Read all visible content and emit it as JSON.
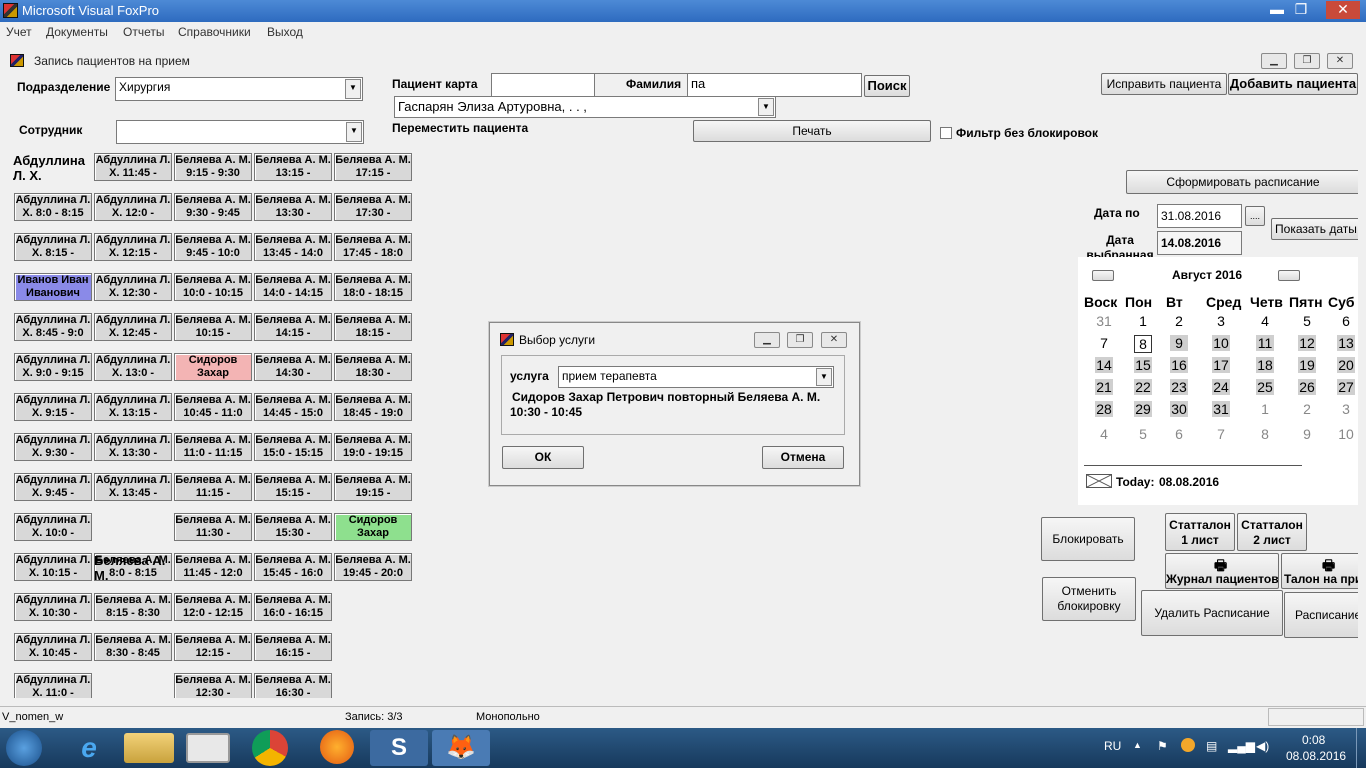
{
  "app": {
    "title": "Microsoft Visual FoxPro",
    "menu": [
      "Учет",
      "Документы",
      "Отчеты",
      "Справочники",
      "Выход"
    ]
  },
  "form": {
    "title": "Запись пациентов на прием",
    "department_label": "Подразделение",
    "department_value": "Хирургия",
    "employee_label": "Сотрудник",
    "employee_value": "",
    "patient_card_label": "Пациент карта",
    "patient_card_value": "",
    "surname_label": "Фамилия",
    "surname_value": "па",
    "search_button": "Поиск",
    "patient_combo_value": "Гаспарян Элиза Артуровна,   .   .    ,",
    "move_patient_label": "Переместить пациента",
    "print_button": "Печать",
    "filter_label": "Фильтр без блокировок",
    "edit_patient_button": "Исправить пациента",
    "add_patient_button": "Добавить пациента",
    "make_schedule_button": "Сформировать расписание",
    "date_to_label": "Дата по",
    "date_to_value": "31.08.2016",
    "date_picker_button": "....",
    "show_dates_button": "Показать даты",
    "date_selected_label": "Дата выбранная",
    "date_selected_value": "14.08.2016",
    "block_button": "Блокировать",
    "unblock_button": "Отменить блокировку",
    "stat_1_button": "Статталон 1 лист",
    "stat_2_button": "Статталон 2 лист",
    "journal_button": "Журнал пациентов",
    "talon_button": "Талон на при",
    "delete_schedule_button": "Удалить Расписание",
    "schedule_button": "Расписание"
  },
  "calendar": {
    "month_label": "Август 2016",
    "weekdays": [
      "Воск",
      "Пон",
      "Вт",
      "Сред",
      "Четв",
      "Пятн",
      "Суб"
    ],
    "rows": [
      [
        "31",
        "1",
        "2",
        "3",
        "4",
        "5",
        "6"
      ],
      [
        "7",
        "8",
        "9",
        "10",
        "11",
        "12",
        "13"
      ],
      [
        "14",
        "15",
        "16",
        "17",
        "18",
        "19",
        "20"
      ],
      [
        "21",
        "22",
        "23",
        "24",
        "25",
        "26",
        "27"
      ],
      [
        "28",
        "29",
        "30",
        "31",
        "1",
        "2",
        "3"
      ],
      [
        "4",
        "5",
        "6",
        "7",
        "8",
        "9",
        "10"
      ]
    ],
    "today_label": "Today:",
    "today_value": "08.08.2016"
  },
  "doctors": {
    "doc1_name": "Абдуллина Л. Х.",
    "doc2_name": "Беляева А. М."
  },
  "slots_col1": [
    "Абдуллина Л. Х. 8:0 - 8:15",
    "Абдуллина Л. Х. 8:15 -",
    "Иванов Иван Иванович",
    "Абдуллина Л. Х. 8:45 - 9:0",
    "Абдуллина Л. Х. 9:0 - 9:15",
    "Абдуллина Л. Х. 9:15 -",
    "Абдуллина Л. Х. 9:30 -",
    "Абдуллина Л. Х. 9:45 -",
    "Абдуллина Л. Х. 10:0 -",
    "Абдуллина Л. Х. 10:15 -",
    "Абдуллина Л. Х. 10:30 -",
    "Абдуллина Л. Х. 10:45 -",
    "Абдуллина Л. Х. 11:0 -"
  ],
  "slots_col2": [
    "Абдуллина Л. Х. 11:45 -",
    "Абдуллина Л. Х. 12:0 -",
    "Абдуллина Л. Х. 12:15 -",
    "Абдуллина Л. Х. 12:30 -",
    "Абдуллина Л. Х. 12:45 -",
    "Абдуллина Л. Х. 13:0 -",
    "Абдуллина Л. Х. 13:15 -",
    "Абдуллина Л. Х. 13:30 -",
    "Абдуллина Л. Х. 13:45 -",
    "Беляева А. М. 8:0 - 8:15",
    "Беляева А. М. 8:15 - 8:30",
    "Беляева А. М. 8:30 - 8:45"
  ],
  "slots_col3": [
    "Беляева А. М. 9:15 - 9:30",
    "Беляева А. М. 9:30 - 9:45",
    "Беляева А. М. 9:45 - 10:0",
    "Беляева А. М. 10:0 - 10:15",
    "Беляева А. М. 10:15 -",
    "Сидоров Захар",
    "Беляева А. М. 10:45 - 11:0",
    "Беляева А. М. 11:0 - 11:15",
    "Беляева А. М. 11:15 -",
    "Беляева А. М. 11:30 -",
    "Беляева А. М. 11:45 - 12:0",
    "Беляева А. М. 12:0 - 12:15",
    "Беляева А. М. 12:15 -",
    "Беляева А. М. 12:30 -"
  ],
  "slots_col4": [
    "Беляева А. М. 13:15 -",
    "Беляева А. М. 13:30 -",
    "Беляева А. М. 13:45 - 14:0",
    "Беляева А. М. 14:0 - 14:15",
    "Беляева А. М. 14:15 -",
    "Беляева А. М. 14:30 -",
    "Беляева А. М. 14:45 - 15:0",
    "Беляева А. М. 15:0 - 15:15",
    "Беляева А. М. 15:15 -",
    "Беляева А. М. 15:30 -",
    "Беляева А. М. 15:45 - 16:0",
    "Беляева А. М. 16:0 - 16:15",
    "Беляева А. М. 16:15 -",
    "Беляева А. М. 16:30 -"
  ],
  "slots_col5": [
    "Беляева А. М. 17:15 -",
    "Беляева А. М. 17:30 -",
    "Беляева А. М. 17:45 - 18:0",
    "Беляева А. М. 18:0 - 18:15",
    "Беляева А. М. 18:15 -",
    "Беляева А. М. 18:30 -",
    "Беляева А. М. 18:45 - 19:0",
    "Беляева А. М. 19:0 - 19:15",
    "Беляева А. М. 19:15 -",
    "Сидоров Захар",
    "Беляева А. М. 19:45 - 20:0"
  ],
  "dialog": {
    "title": "Выбор услуги",
    "service_label": "услуга",
    "service_value": "прием терапевта",
    "info_line1": "Сидоров Захар Петрович повторный Беляева А. М.",
    "info_line2": "10:30 - 10:45",
    "ok_button": "ОК",
    "cancel_button": "Отмена"
  },
  "status": {
    "left": "V_nomen_w",
    "record": "Запись: 3/3",
    "mode": "Монопольно"
  },
  "taskbar": {
    "lang": "RU",
    "time": "0:08",
    "date": "08.08.2016"
  },
  "colors": {
    "blue_slot": "#8a8ae8",
    "pink_slot": "#f3b4b4",
    "green_slot": "#8ee08e"
  }
}
